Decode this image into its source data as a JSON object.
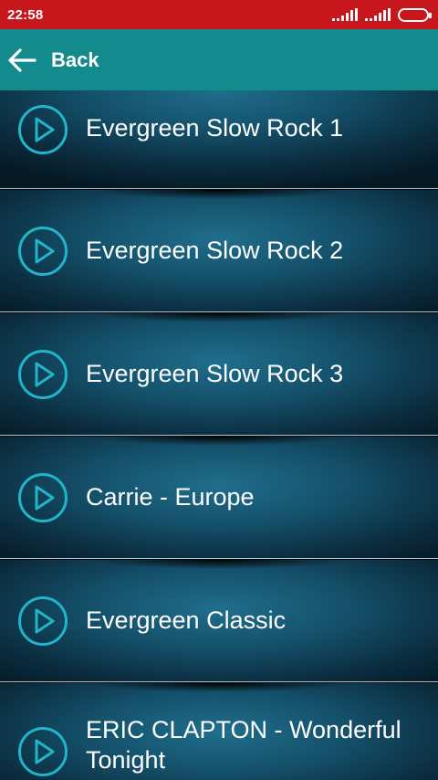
{
  "status_bar": {
    "time": "22:58"
  },
  "app_bar": {
    "back_label": "Back"
  },
  "colors": {
    "status_bar": "#c8161d",
    "app_bar": "#138a8c",
    "accent": "#22b5c9"
  },
  "tracks": [
    {
      "title": "Evergreen Slow Rock 1"
    },
    {
      "title": "Evergreen Slow Rock 2"
    },
    {
      "title": "Evergreen Slow Rock 3"
    },
    {
      "title": "Carrie - Europe"
    },
    {
      "title": "Evergreen Classic"
    },
    {
      "title": "ERIC CLAPTON - Wonderful Tonight"
    }
  ]
}
